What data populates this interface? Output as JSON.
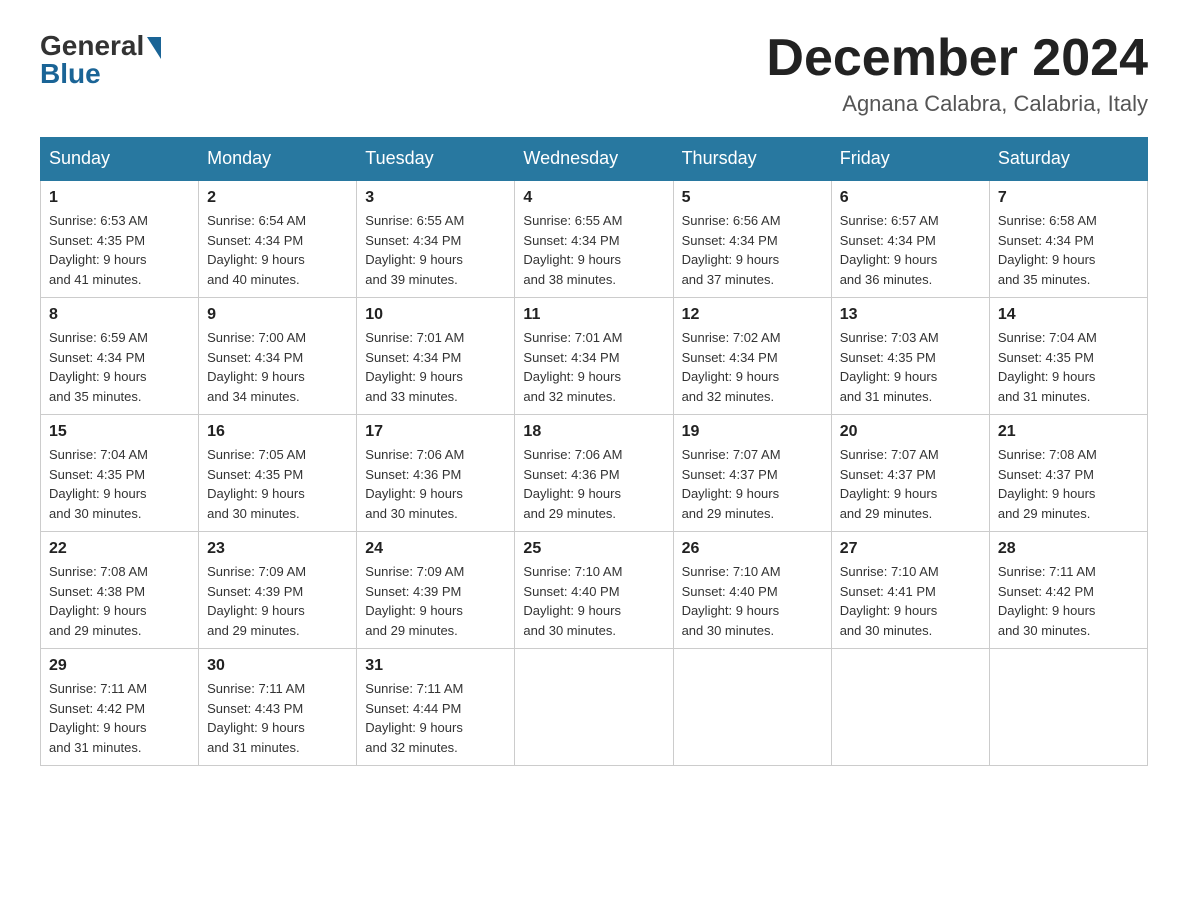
{
  "logo": {
    "general": "General",
    "blue": "Blue"
  },
  "title": {
    "month_year": "December 2024",
    "location": "Agnana Calabra, Calabria, Italy"
  },
  "days_of_week": [
    "Sunday",
    "Monday",
    "Tuesday",
    "Wednesday",
    "Thursday",
    "Friday",
    "Saturday"
  ],
  "weeks": [
    [
      {
        "day": "1",
        "sunrise": "6:53 AM",
        "sunset": "4:35 PM",
        "daylight": "9 hours and 41 minutes."
      },
      {
        "day": "2",
        "sunrise": "6:54 AM",
        "sunset": "4:34 PM",
        "daylight": "9 hours and 40 minutes."
      },
      {
        "day": "3",
        "sunrise": "6:55 AM",
        "sunset": "4:34 PM",
        "daylight": "9 hours and 39 minutes."
      },
      {
        "day": "4",
        "sunrise": "6:55 AM",
        "sunset": "4:34 PM",
        "daylight": "9 hours and 38 minutes."
      },
      {
        "day": "5",
        "sunrise": "6:56 AM",
        "sunset": "4:34 PM",
        "daylight": "9 hours and 37 minutes."
      },
      {
        "day": "6",
        "sunrise": "6:57 AM",
        "sunset": "4:34 PM",
        "daylight": "9 hours and 36 minutes."
      },
      {
        "day": "7",
        "sunrise": "6:58 AM",
        "sunset": "4:34 PM",
        "daylight": "9 hours and 35 minutes."
      }
    ],
    [
      {
        "day": "8",
        "sunrise": "6:59 AM",
        "sunset": "4:34 PM",
        "daylight": "9 hours and 35 minutes."
      },
      {
        "day": "9",
        "sunrise": "7:00 AM",
        "sunset": "4:34 PM",
        "daylight": "9 hours and 34 minutes."
      },
      {
        "day": "10",
        "sunrise": "7:01 AM",
        "sunset": "4:34 PM",
        "daylight": "9 hours and 33 minutes."
      },
      {
        "day": "11",
        "sunrise": "7:01 AM",
        "sunset": "4:34 PM",
        "daylight": "9 hours and 32 minutes."
      },
      {
        "day": "12",
        "sunrise": "7:02 AM",
        "sunset": "4:34 PM",
        "daylight": "9 hours and 32 minutes."
      },
      {
        "day": "13",
        "sunrise": "7:03 AM",
        "sunset": "4:35 PM",
        "daylight": "9 hours and 31 minutes."
      },
      {
        "day": "14",
        "sunrise": "7:04 AM",
        "sunset": "4:35 PM",
        "daylight": "9 hours and 31 minutes."
      }
    ],
    [
      {
        "day": "15",
        "sunrise": "7:04 AM",
        "sunset": "4:35 PM",
        "daylight": "9 hours and 30 minutes."
      },
      {
        "day": "16",
        "sunrise": "7:05 AM",
        "sunset": "4:35 PM",
        "daylight": "9 hours and 30 minutes."
      },
      {
        "day": "17",
        "sunrise": "7:06 AM",
        "sunset": "4:36 PM",
        "daylight": "9 hours and 30 minutes."
      },
      {
        "day": "18",
        "sunrise": "7:06 AM",
        "sunset": "4:36 PM",
        "daylight": "9 hours and 29 minutes."
      },
      {
        "day": "19",
        "sunrise": "7:07 AM",
        "sunset": "4:37 PM",
        "daylight": "9 hours and 29 minutes."
      },
      {
        "day": "20",
        "sunrise": "7:07 AM",
        "sunset": "4:37 PM",
        "daylight": "9 hours and 29 minutes."
      },
      {
        "day": "21",
        "sunrise": "7:08 AM",
        "sunset": "4:37 PM",
        "daylight": "9 hours and 29 minutes."
      }
    ],
    [
      {
        "day": "22",
        "sunrise": "7:08 AM",
        "sunset": "4:38 PM",
        "daylight": "9 hours and 29 minutes."
      },
      {
        "day": "23",
        "sunrise": "7:09 AM",
        "sunset": "4:39 PM",
        "daylight": "9 hours and 29 minutes."
      },
      {
        "day": "24",
        "sunrise": "7:09 AM",
        "sunset": "4:39 PM",
        "daylight": "9 hours and 29 minutes."
      },
      {
        "day": "25",
        "sunrise": "7:10 AM",
        "sunset": "4:40 PM",
        "daylight": "9 hours and 30 minutes."
      },
      {
        "day": "26",
        "sunrise": "7:10 AM",
        "sunset": "4:40 PM",
        "daylight": "9 hours and 30 minutes."
      },
      {
        "day": "27",
        "sunrise": "7:10 AM",
        "sunset": "4:41 PM",
        "daylight": "9 hours and 30 minutes."
      },
      {
        "day": "28",
        "sunrise": "7:11 AM",
        "sunset": "4:42 PM",
        "daylight": "9 hours and 30 minutes."
      }
    ],
    [
      {
        "day": "29",
        "sunrise": "7:11 AM",
        "sunset": "4:42 PM",
        "daylight": "9 hours and 31 minutes."
      },
      {
        "day": "30",
        "sunrise": "7:11 AM",
        "sunset": "4:43 PM",
        "daylight": "9 hours and 31 minutes."
      },
      {
        "day": "31",
        "sunrise": "7:11 AM",
        "sunset": "4:44 PM",
        "daylight": "9 hours and 32 minutes."
      },
      null,
      null,
      null,
      null
    ]
  ]
}
